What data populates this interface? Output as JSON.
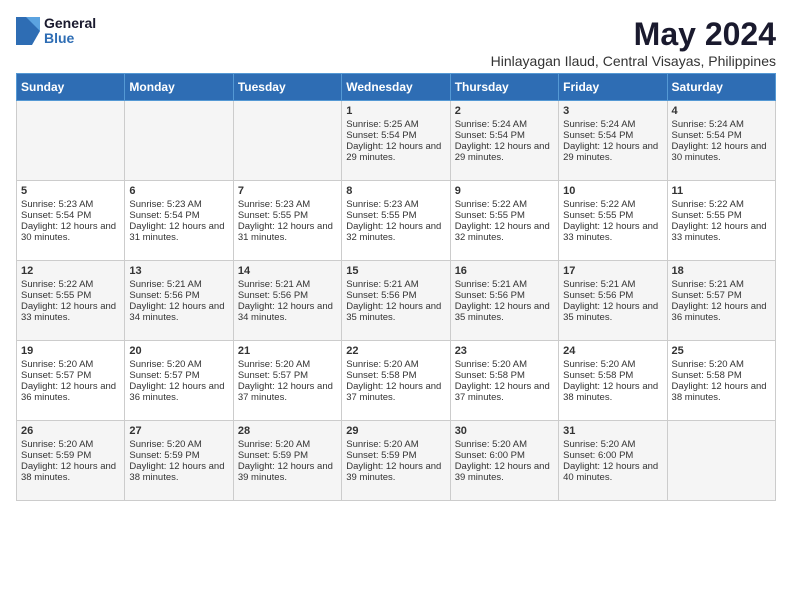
{
  "header": {
    "logo": {
      "general": "General",
      "blue": "Blue"
    },
    "month": "May 2024",
    "location": "Hinlayagan Ilaud, Central Visayas, Philippines"
  },
  "days_of_week": [
    "Sunday",
    "Monday",
    "Tuesday",
    "Wednesday",
    "Thursday",
    "Friday",
    "Saturday"
  ],
  "weeks": [
    [
      {
        "day": "",
        "sunrise": "",
        "sunset": "",
        "daylight": ""
      },
      {
        "day": "",
        "sunrise": "",
        "sunset": "",
        "daylight": ""
      },
      {
        "day": "",
        "sunrise": "",
        "sunset": "",
        "daylight": ""
      },
      {
        "day": "1",
        "sunrise": "5:25 AM",
        "sunset": "5:54 PM",
        "daylight": "12 hours and 29 minutes."
      },
      {
        "day": "2",
        "sunrise": "5:24 AM",
        "sunset": "5:54 PM",
        "daylight": "12 hours and 29 minutes."
      },
      {
        "day": "3",
        "sunrise": "5:24 AM",
        "sunset": "5:54 PM",
        "daylight": "12 hours and 29 minutes."
      },
      {
        "day": "4",
        "sunrise": "5:24 AM",
        "sunset": "5:54 PM",
        "daylight": "12 hours and 30 minutes."
      }
    ],
    [
      {
        "day": "5",
        "sunrise": "5:23 AM",
        "sunset": "5:54 PM",
        "daylight": "12 hours and 30 minutes."
      },
      {
        "day": "6",
        "sunrise": "5:23 AM",
        "sunset": "5:54 PM",
        "daylight": "12 hours and 31 minutes."
      },
      {
        "day": "7",
        "sunrise": "5:23 AM",
        "sunset": "5:55 PM",
        "daylight": "12 hours and 31 minutes."
      },
      {
        "day": "8",
        "sunrise": "5:23 AM",
        "sunset": "5:55 PM",
        "daylight": "12 hours and 32 minutes."
      },
      {
        "day": "9",
        "sunrise": "5:22 AM",
        "sunset": "5:55 PM",
        "daylight": "12 hours and 32 minutes."
      },
      {
        "day": "10",
        "sunrise": "5:22 AM",
        "sunset": "5:55 PM",
        "daylight": "12 hours and 33 minutes."
      },
      {
        "day": "11",
        "sunrise": "5:22 AM",
        "sunset": "5:55 PM",
        "daylight": "12 hours and 33 minutes."
      }
    ],
    [
      {
        "day": "12",
        "sunrise": "5:22 AM",
        "sunset": "5:55 PM",
        "daylight": "12 hours and 33 minutes."
      },
      {
        "day": "13",
        "sunrise": "5:21 AM",
        "sunset": "5:56 PM",
        "daylight": "12 hours and 34 minutes."
      },
      {
        "day": "14",
        "sunrise": "5:21 AM",
        "sunset": "5:56 PM",
        "daylight": "12 hours and 34 minutes."
      },
      {
        "day": "15",
        "sunrise": "5:21 AM",
        "sunset": "5:56 PM",
        "daylight": "12 hours and 35 minutes."
      },
      {
        "day": "16",
        "sunrise": "5:21 AM",
        "sunset": "5:56 PM",
        "daylight": "12 hours and 35 minutes."
      },
      {
        "day": "17",
        "sunrise": "5:21 AM",
        "sunset": "5:56 PM",
        "daylight": "12 hours and 35 minutes."
      },
      {
        "day": "18",
        "sunrise": "5:21 AM",
        "sunset": "5:57 PM",
        "daylight": "12 hours and 36 minutes."
      }
    ],
    [
      {
        "day": "19",
        "sunrise": "5:20 AM",
        "sunset": "5:57 PM",
        "daylight": "12 hours and 36 minutes."
      },
      {
        "day": "20",
        "sunrise": "5:20 AM",
        "sunset": "5:57 PM",
        "daylight": "12 hours and 36 minutes."
      },
      {
        "day": "21",
        "sunrise": "5:20 AM",
        "sunset": "5:57 PM",
        "daylight": "12 hours and 37 minutes."
      },
      {
        "day": "22",
        "sunrise": "5:20 AM",
        "sunset": "5:58 PM",
        "daylight": "12 hours and 37 minutes."
      },
      {
        "day": "23",
        "sunrise": "5:20 AM",
        "sunset": "5:58 PM",
        "daylight": "12 hours and 37 minutes."
      },
      {
        "day": "24",
        "sunrise": "5:20 AM",
        "sunset": "5:58 PM",
        "daylight": "12 hours and 38 minutes."
      },
      {
        "day": "25",
        "sunrise": "5:20 AM",
        "sunset": "5:58 PM",
        "daylight": "12 hours and 38 minutes."
      }
    ],
    [
      {
        "day": "26",
        "sunrise": "5:20 AM",
        "sunset": "5:59 PM",
        "daylight": "12 hours and 38 minutes."
      },
      {
        "day": "27",
        "sunrise": "5:20 AM",
        "sunset": "5:59 PM",
        "daylight": "12 hours and 38 minutes."
      },
      {
        "day": "28",
        "sunrise": "5:20 AM",
        "sunset": "5:59 PM",
        "daylight": "12 hours and 39 minutes."
      },
      {
        "day": "29",
        "sunrise": "5:20 AM",
        "sunset": "5:59 PM",
        "daylight": "12 hours and 39 minutes."
      },
      {
        "day": "30",
        "sunrise": "5:20 AM",
        "sunset": "6:00 PM",
        "daylight": "12 hours and 39 minutes."
      },
      {
        "day": "31",
        "sunrise": "5:20 AM",
        "sunset": "6:00 PM",
        "daylight": "12 hours and 40 minutes."
      },
      {
        "day": "",
        "sunrise": "",
        "sunset": "",
        "daylight": ""
      }
    ]
  ]
}
